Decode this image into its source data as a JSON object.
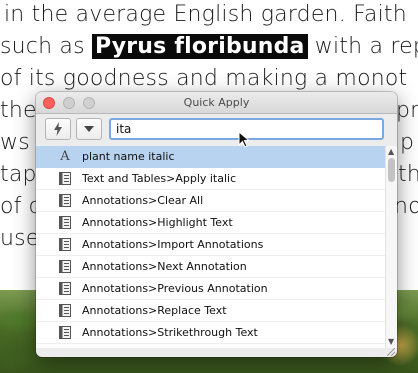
{
  "document": {
    "lines": [
      {
        "text": "in the average English garden. Faith"
      },
      {
        "before": "such as ",
        "highlight": "Pyrus floribunda",
        "after": " with a rep"
      },
      {
        "text": "of its goodness and making a monot"
      },
      {
        "text": "the"
      },
      {
        "text": "pr"
      },
      {
        "text": "ws s"
      },
      {
        "text": "p"
      },
      {
        "text": "tape"
      },
      {
        "text": "th"
      },
      {
        "text": "of co"
      },
      {
        "text": "not"
      },
      {
        "text": "use"
      }
    ]
  },
  "window": {
    "title": "Quick Apply",
    "search": {
      "value": "ita",
      "placeholder": ""
    },
    "items": [
      {
        "label": "plant name italic",
        "icon": "character-style-icon",
        "selected": true
      },
      {
        "label": "Text and Tables>Apply italic",
        "icon": "menu-command-icon",
        "selected": false
      },
      {
        "label": "Annotations>Clear All",
        "icon": "menu-command-icon",
        "selected": false
      },
      {
        "label": "Annotations>Highlight Text",
        "icon": "menu-command-icon",
        "selected": false
      },
      {
        "label": "Annotations>Import Annotations",
        "icon": "menu-command-icon",
        "selected": false
      },
      {
        "label": "Annotations>Next Annotation",
        "icon": "menu-command-icon",
        "selected": false
      },
      {
        "label": "Annotations>Previous Annotation",
        "icon": "menu-command-icon",
        "selected": false
      },
      {
        "label": "Annotations>Replace Text",
        "icon": "menu-command-icon",
        "selected": false
      },
      {
        "label": "Annotations>Strikethrough Text",
        "icon": "menu-command-icon",
        "selected": false
      }
    ]
  },
  "colors": {
    "selection": "#b8d3f0",
    "search_focus": "#7aa8e0",
    "close_button": "#fc605c",
    "highlight_bg": "#0a0a0a"
  }
}
